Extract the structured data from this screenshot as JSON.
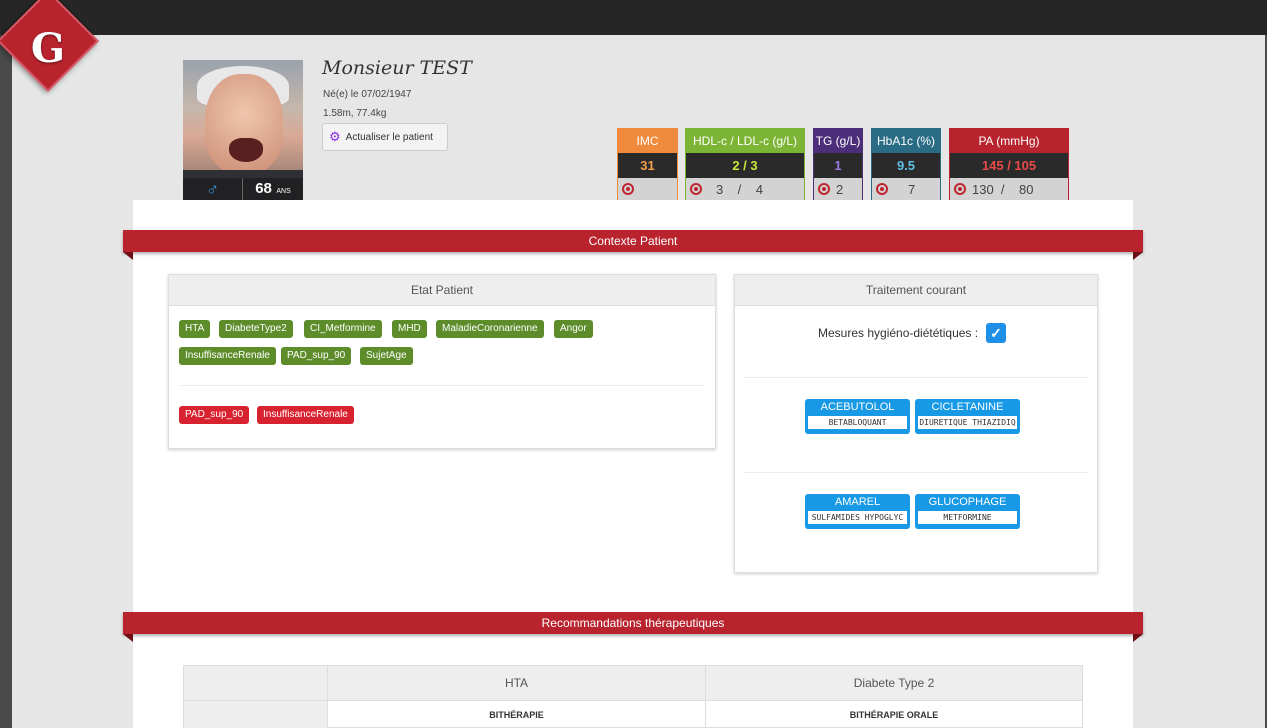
{
  "app": {
    "logo_letter": "G"
  },
  "patient": {
    "name": "Monsieur TEST",
    "dob": "Né(e) le 07/02/1947",
    "size_weight": "1.58m, 77.4kg",
    "gender_symbol": "♂",
    "age": "68",
    "age_unit": "ANS",
    "update_button": "Actualiser le patient"
  },
  "metrics": [
    {
      "label": "IMC",
      "value": "31",
      "target": "",
      "color": "#f08a3c",
      "value_color": "#f5a04a"
    },
    {
      "label": "HDL-c / LDL-c (g/L)",
      "value": "2 / 3",
      "target": "3    /    4",
      "color": "#7cb535",
      "value_color": "#c8e83c"
    },
    {
      "label": "TG (g/L)",
      "value": "1",
      "target": "2",
      "color": "#4b2d7a",
      "value_color": "#9a7ae0"
    },
    {
      "label": "HbA1c (%)",
      "value": "9.5",
      "target": "7",
      "color": "#2b6c85",
      "value_color": "#5fc0e8"
    },
    {
      "label": "PA (mmHg)",
      "value": "145 / 105",
      "target": "130  /    80",
      "color": "#b8232e",
      "value_color": "#e84a4a"
    }
  ],
  "contexte": {
    "title": "Contexte Patient",
    "etat": {
      "title": "Etat Patient",
      "green_tags": [
        "HTA",
        "DiabeteType2",
        "CI_Metformine",
        "MHD",
        "MaladieCoronarienne",
        "Angor",
        "InsuffisanceRenale",
        "PAD_sup_90",
        "SujetAge"
      ],
      "red_tags": [
        "PAD_sup_90",
        "InsuffisanceRenale"
      ]
    },
    "traitement": {
      "title": "Traitement courant",
      "hygieno_label": "Mesures hygiéno-diététiques :",
      "hygieno_checked": "✓",
      "drugs": [
        {
          "name": "ACEBUTOLOL",
          "class": "BETABLOQUANT"
        },
        {
          "name": "CICLETANINE",
          "class": "DIURETIQUE THIAZIDIQ"
        },
        {
          "name": "AMAREL",
          "class": "SULFAMIDES HYPOGLYC"
        },
        {
          "name": "GLUCOPHAGE",
          "class": "METFORMINE"
        }
      ]
    }
  },
  "recommandations": {
    "title": "Recommandations thérapeutiques",
    "columns": [
      "",
      "HTA",
      "Diabete Type 2"
    ],
    "row1": [
      "",
      "BITHÉRAPIE",
      "BITHÉRAPIE ORALE"
    ]
  }
}
